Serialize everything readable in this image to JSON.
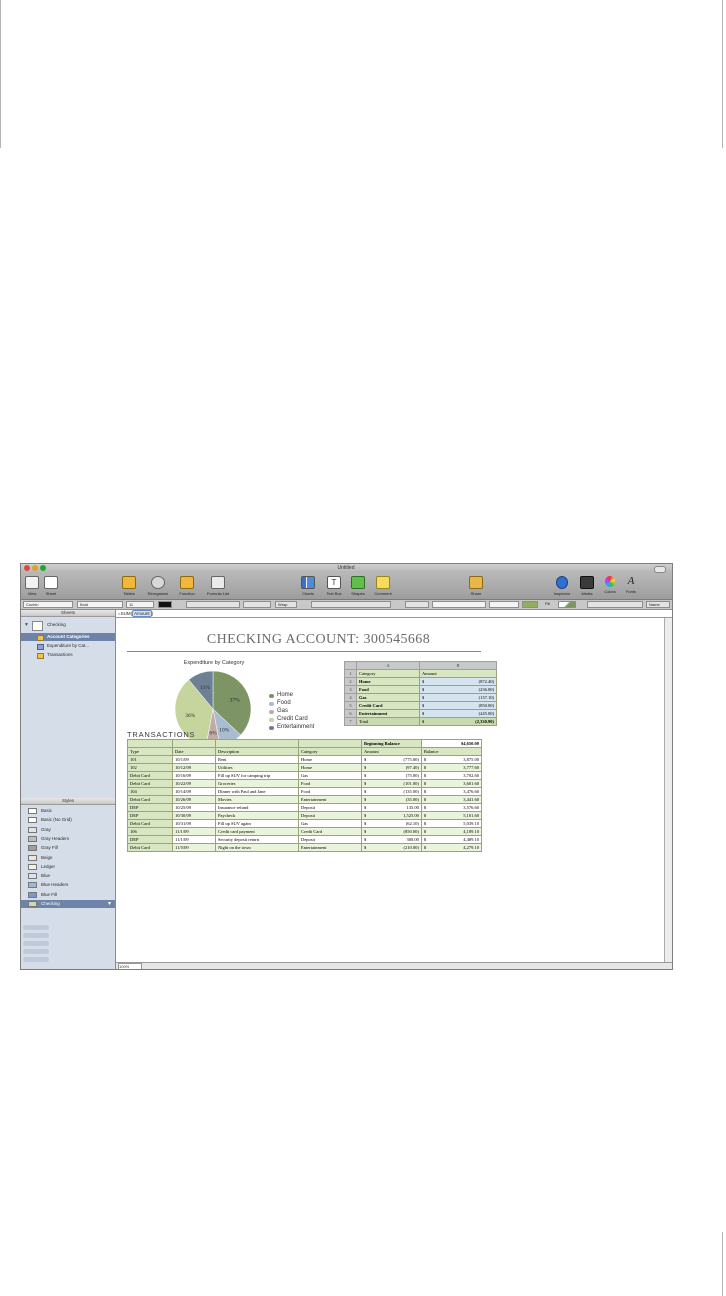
{
  "window": {
    "title": "Untitled"
  },
  "toolbar": {
    "view": "View",
    "sheet": "Sheet",
    "tables": "Tables",
    "reorganize": "Reorganize",
    "function": "Function",
    "formula_list": "Formula List",
    "charts": "Charts",
    "text_box": "Text Box",
    "shapes": "Shapes",
    "comment": "Comment",
    "share": "Share",
    "inspector": "Inspector",
    "media": "Media",
    "colors": "Colors",
    "fonts": "Fonts"
  },
  "format_bar": {
    "font": "Cochin",
    "style": "Bold",
    "size": "11",
    "wrap": "Wrap",
    "fill": "Fill",
    "name": "Name"
  },
  "formula": {
    "prefix": "=SUM(",
    "token": "Amount",
    "suffix": ")"
  },
  "sidebar": {
    "sheets_header": "Sheets",
    "sheet": "Checking",
    "tables": [
      {
        "label": "Account Categories",
        "selected": true,
        "kind": "table"
      },
      {
        "label": "Expenditure by Cat...",
        "selected": false,
        "kind": "chart"
      },
      {
        "label": "Transactions",
        "selected": false,
        "kind": "table"
      }
    ],
    "styles_header": "Styles",
    "styles": [
      {
        "label": "Basic",
        "color": "#ffffff"
      },
      {
        "label": "Basic (No Grid)",
        "color": "#ffffff"
      },
      {
        "label": "Gray",
        "color": "#e3e3e3"
      },
      {
        "label": "Gray Headers",
        "color": "#bdbdbd"
      },
      {
        "label": "Gray Fill",
        "color": "#9e9e9e"
      },
      {
        "label": "Beige",
        "color": "#efe6cf"
      },
      {
        "label": "Ledger",
        "color": "#f2f2e4"
      },
      {
        "label": "Blue",
        "color": "#d7e2f2"
      },
      {
        "label": "Blue Headers",
        "color": "#9fb6dc"
      },
      {
        "label": "Blue Fill",
        "color": "#7b98cc"
      },
      {
        "label": "Checking",
        "color": "#c9dbae"
      }
    ]
  },
  "document": {
    "title": "CHECKING ACCOUNT: 300545668"
  },
  "chart_data": {
    "type": "pie",
    "title": "Expenditure by Category",
    "categories": [
      "Home",
      "Food",
      "Gas",
      "Credit Card",
      "Entertainment"
    ],
    "values": [
      37,
      10,
      6,
      36,
      11
    ],
    "colors": [
      "#7d9464",
      "#a9bcd0",
      "#c2aba5",
      "#c6d49d",
      "#6e8194"
    ],
    "legend": "right"
  },
  "account_categories": {
    "col_a": "A",
    "col_b": "B",
    "header": [
      "Category",
      "Amount"
    ],
    "rows": [
      {
        "n": "1",
        "cat": "Category",
        "amt": "Amount"
      },
      {
        "n": "2",
        "cat": "Home",
        "cur": "$",
        "amt": "(872.40)"
      },
      {
        "n": "3",
        "cat": "Food",
        "cur": "$",
        "amt": "(236.00)"
      },
      {
        "n": "4",
        "cat": "Gas",
        "cur": "$",
        "amt": "(137.10)"
      },
      {
        "n": "5",
        "cat": "Credit Card",
        "cur": "$",
        "amt": "(850.00)"
      },
      {
        "n": "6",
        "cat": "Entertainment",
        "cur": "$",
        "amt": "(245.00)"
      },
      {
        "n": "7",
        "cat": "Total",
        "cur": "$",
        "amt": "(2,330.90)"
      }
    ]
  },
  "transactions": {
    "title": "TRANSACTIONS",
    "beginning_label": "Beginning Balance",
    "beginning_value": "$4,650.00",
    "headers": [
      "Type",
      "Date",
      "Description",
      "Category",
      "Amount",
      "Balance"
    ],
    "rows": [
      [
        "101",
        "10/1/09",
        "Rent",
        "Home",
        "$",
        "(775.00)",
        "$",
        "3,875.00"
      ],
      [
        "102",
        "10/12/09",
        "Utilities",
        "Home",
        "$",
        "(97.40)",
        "$",
        "3,777.60"
      ],
      [
        "Debit Card",
        "10/16/09",
        "Fill up SUV for camping trip",
        "Gas",
        "$",
        "(75.00)",
        "$",
        "3,702.60"
      ],
      [
        "Debit Card",
        "10/22/09",
        "Groceries",
        "Food",
        "$",
        "(101.00)",
        "$",
        "3,601.60"
      ],
      [
        "104",
        "10/14/09",
        "Dinner with Paul and Jane",
        "Food",
        "$",
        "(135.00)",
        "$",
        "3,476.60"
      ],
      [
        "Debit Card",
        "10/26/09",
        "Movies",
        "Entertainment",
        "$",
        "(35.00)",
        "$",
        "3,441.60"
      ],
      [
        "DEP",
        "10/25/09",
        "Insurance refund",
        "Deposit",
        "$",
        "135.00",
        "$",
        "3,576.60"
      ],
      [
        "DEP",
        "10/30/09",
        "Paycheck",
        "Deposit",
        "$",
        "1,525.00",
        "$",
        "5,101.60"
      ],
      [
        "Debit Card",
        "10/31/09",
        "Fill up SUV again",
        "Gas",
        "$",
        "(62.10)",
        "$",
        "5,039.10"
      ],
      [
        "106",
        "11/1/09",
        "Credit card payment",
        "Credit Card",
        "$",
        "(850.00)",
        "$",
        "4,189.10"
      ],
      [
        "DEP",
        "11/1/09",
        "Security deposit return",
        "Deposit",
        "$",
        "300.00",
        "$",
        "4,489.10"
      ],
      [
        "Debit Card",
        "11/5/09",
        "Night on the town",
        "Entertainment",
        "$",
        "(210.00)",
        "$",
        "4,279.10"
      ]
    ]
  },
  "status": {
    "zoom": "100%"
  }
}
